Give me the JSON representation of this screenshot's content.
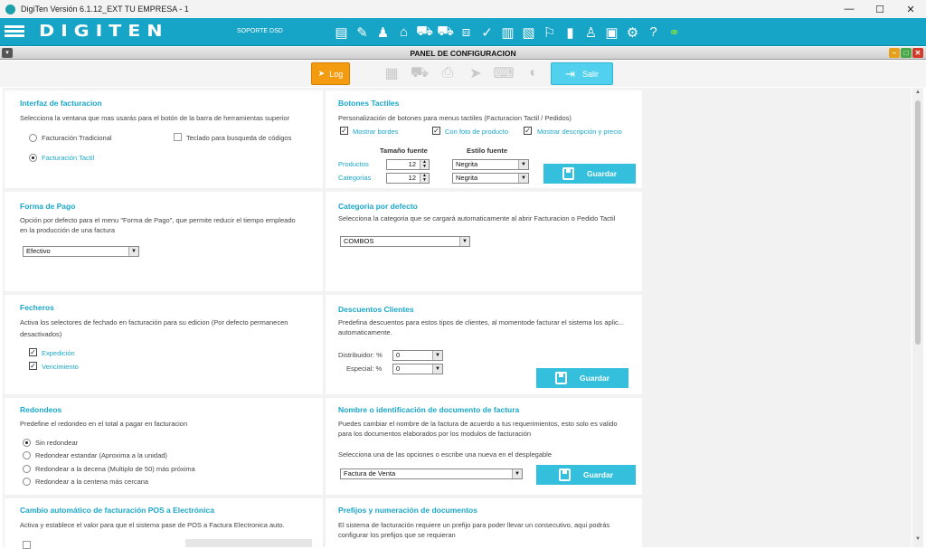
{
  "window": {
    "title": "DigiTen Versión 6.1.12_EXT TU EMPRESA - 1",
    "minimize": "—",
    "maximize": "☐",
    "close": "✕"
  },
  "topbar": {
    "logo": "DIGITEN",
    "soporte": "SOPORTE DSD",
    "icons": [
      "invoice-icon",
      "tag-icon",
      "user-icon",
      "price-tag-icon",
      "cart-add-icon",
      "cart-icon",
      "box-icon",
      "checklist-icon",
      "document-icon",
      "receipt-icon",
      "bank-icon",
      "chart-icon",
      "users-icon",
      "photo-icon",
      "gear-icon",
      "help-icon",
      "link-icon"
    ],
    "glyphs": [
      "▤",
      "✎",
      "♟",
      "⌂",
      "⛟",
      "⛟",
      "⧈",
      "✓",
      "▥",
      "▧",
      "⚐",
      "▮",
      "♙",
      "▣",
      "⚙",
      "?",
      "⚭"
    ]
  },
  "panel": {
    "title": "PANEL DE CONFIGURACION",
    "dd": "▾",
    "btn_min": "–",
    "btn_max": "□",
    "btn_close": "✕"
  },
  "actions": {
    "log": "Log",
    "salir": "Salir",
    "log_glyph": "➤",
    "salir_glyph": "⇥",
    "icons": [
      {
        "name": "image-icon",
        "g": "▦"
      },
      {
        "name": "cart-icon",
        "g": "⛟"
      },
      {
        "name": "printer-icon",
        "g": "⎙"
      },
      {
        "name": "send-icon",
        "g": "➤"
      },
      {
        "name": "keyboard-icon",
        "g": "⌨"
      },
      {
        "name": "bulb-icon",
        "g": "◐"
      }
    ]
  },
  "interfaz": {
    "title": "Interfaz de facturacion",
    "desc": "Selecciona la ventana que mas usarás para el botón de la barra de herramientas superior",
    "opt1": "Facturación Tradicional",
    "opt2": "Facturación Tactil",
    "teclado": "Teclado para busqueda de códigos"
  },
  "botones": {
    "title": "Botones Tactiles",
    "desc": "Personalización de botones para  menus tactiles (Facturacion Tactil / Pedidos)",
    "chk1": "Mostrar bordes",
    "chk2": "Con foto de producto",
    "chk3": "Mostrar descripción y precio",
    "h_size": "Tamaño fuente",
    "h_style": "Estilo fuente",
    "row1": "Productos",
    "row2": "Categorias",
    "size1": "12",
    "size2": "12",
    "style1": "Negrita",
    "style2": "Negrita",
    "guardar": "Guardar"
  },
  "pago": {
    "title": "Forma de Pago",
    "desc1": "Opción por defecto para el menu \"Forma de Pago\", que permite reducir el tiempo  empleado",
    "desc2": "en la producción de una factura",
    "value": "Efectivo"
  },
  "categoria": {
    "title": "Categoria por defecto",
    "desc": "Selecciona la categoria que se cargará automaticamente al abrir Facturacion o Pedido Tactil",
    "value": "COMBOS"
  },
  "fecheros": {
    "title": "Fecheros",
    "desc1": "Activa los selectores de fechado en facturación para su edicion (Por defecto permanecen",
    "desc2": "desactivados)",
    "chk1": "Expedición",
    "chk2": "Vencimiento"
  },
  "descuentos": {
    "title": "Descuentos Clientes",
    "desc1": "Predefina descuentos para estos tipos de clientes, al momentode facturar el sistema los aplic...",
    "desc2": "automaticamente.",
    "l1": "Distribuidor:  %",
    "l2": "Especial:  %",
    "v1": "0",
    "v2": "0",
    "guardar": "Guardar"
  },
  "redondeos": {
    "title": "Redondeos",
    "desc": "Predefine el redondeo en el total a pagar en facturacion",
    "o1": "Sin redondear",
    "o2": "Redondear estandar (Aproxima a la unidad)",
    "o3": "Redondear a la decena (Multiplo de 50) más próxima",
    "o4": "Redondear a la centena más cercana"
  },
  "nombre": {
    "title": "Nombre o identificación de documento de factura",
    "desc1": "Puedes cambiar el nombre de la factura de acuerdo a tus requerimientos, esto solo es valido",
    "desc2": "para los documentos elaborados por los modulos de facturación",
    "desc3": "Selecciona una de las opciones o escribe una nueva en el desplegable",
    "value": "Factura de Venta",
    "guardar": "Guardar"
  },
  "cambio": {
    "title": "Cambio automático de facturación POS a Electrónica",
    "desc": "Activa y establece el valor para que el sistema  pase de POS a Factura Electronica auto."
  },
  "prefijos": {
    "title": "Prefijos y numeración de documentos",
    "desc1": "El sistema de facturación requiere un prefijo para poder llevar un consecutivo, aqui podrás",
    "desc2": "configurar los prefijos que se requieran"
  },
  "scroll": {
    "up": "▲",
    "down": "▼"
  }
}
